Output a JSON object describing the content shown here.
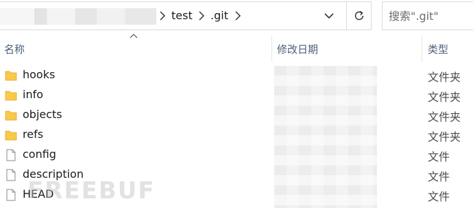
{
  "address_bar": {
    "segments": [
      "test",
      ".git"
    ]
  },
  "search": {
    "placeholder": "搜索\".git\""
  },
  "columns": {
    "name": "名称",
    "date_modified": "修改日期",
    "type": "类型"
  },
  "files": [
    {
      "name": "hooks",
      "type": "文件夹",
      "icon": "folder-icon"
    },
    {
      "name": "info",
      "type": "文件夹",
      "icon": "folder-icon"
    },
    {
      "name": "objects",
      "type": "文件夹",
      "icon": "folder-icon"
    },
    {
      "name": "refs",
      "type": "文件夹",
      "icon": "folder-icon"
    },
    {
      "name": "config",
      "type": "文件",
      "icon": "file-icon"
    },
    {
      "name": "description",
      "type": "文件",
      "icon": "file-icon"
    },
    {
      "name": "HEAD",
      "type": "文件",
      "icon": "file-icon"
    }
  ],
  "watermark": "FREEBUF",
  "colors": {
    "folder": "#F8C94A",
    "header_text": "#4C607A",
    "border": "#D9D9D9"
  }
}
